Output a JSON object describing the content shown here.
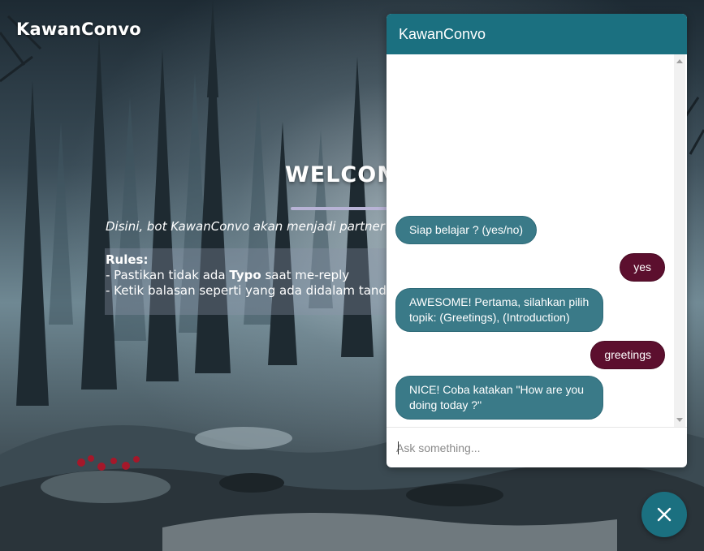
{
  "page": {
    "brand": "KawanConvo",
    "welcome_title": "WELCOM",
    "intro": "Disini, bot KawanConvo akan menjadi partner",
    "rules_heading": "Rules:",
    "rule1_prefix": "- Pastikan tidak ada ",
    "rule1_bold": "Typo",
    "rule1_suffix": " saat me-reply",
    "rule2": "- Ketik balasan seperti yang ada didalam tand"
  },
  "chat": {
    "title": "KawanConvo",
    "input_placeholder": "Ask something...",
    "input_value": "",
    "messages": [
      {
        "sender": "bot",
        "text": "Siap belajar ? (yes/no)"
      },
      {
        "sender": "user",
        "text": "yes"
      },
      {
        "sender": "bot",
        "text": "AWESOME! Pertama, silahkan pilih topik: (Greetings), (Introduction)"
      },
      {
        "sender": "user",
        "text": "greetings"
      },
      {
        "sender": "bot",
        "text": "NICE! Coba katakan \"How are you doing today ?\""
      }
    ]
  },
  "fab": {
    "icon": "close-icon"
  },
  "colors": {
    "accent": "#1b7080",
    "bot_bubble": "#3a7a88",
    "user_bubble": "#5c0f2e"
  }
}
